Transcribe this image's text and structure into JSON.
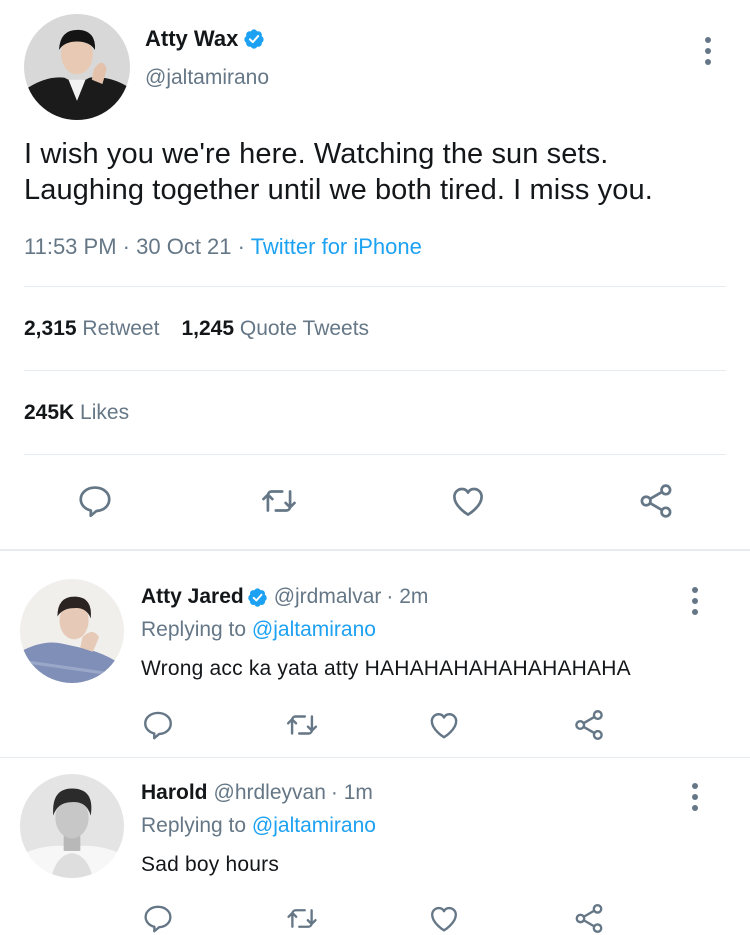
{
  "main_tweet": {
    "author_name": "Atty Wax",
    "handle": "@jaltamirano",
    "verified": true,
    "avatar_icon": "profile-photo",
    "text": "I wish you we're here. Watching the sun sets. Laughing together until we both tired. I miss you.",
    "time": "11:53 PM",
    "date": "30 Oct 21",
    "separator": "·",
    "source": "Twitter for iPhone",
    "retweets_count": "2,315",
    "retweets_label": "Retweet",
    "quotes_count": "1,245",
    "quotes_label": "Quote Tweets",
    "likes_count": "245K",
    "likes_label": "Likes",
    "actions": [
      "reply-icon",
      "retweet-icon",
      "like-icon",
      "share-icon"
    ]
  },
  "replies": [
    {
      "author_name": "Atty Jared",
      "verified": true,
      "handle": "@jrdmalvar",
      "time_ago": "· 2m",
      "replying_prefix": "Replying to",
      "replying_to": "@jaltamirano",
      "text": "Wrong acc ka yata atty HAHAHAHAHAHAHAHAHA"
    },
    {
      "author_name": "Harold",
      "verified": false,
      "handle": "@hrdleyvan",
      "time_ago": "· 1m",
      "replying_prefix": "Replying to",
      "replying_to": "@jaltamirano",
      "text": "Sad boy hours"
    }
  ],
  "colors": {
    "accent": "#1da1f2",
    "secondary_text": "#657786",
    "divider": "#e6ecf0",
    "primary_text": "#14171a"
  }
}
